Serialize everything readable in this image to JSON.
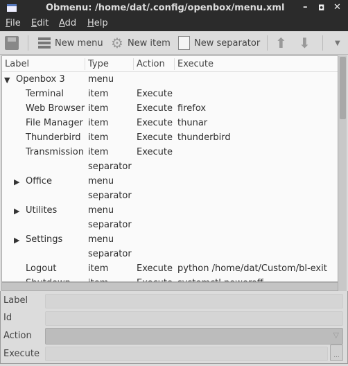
{
  "window": {
    "title": "Obmenu: /home/dat/.config/openbox/menu.xml",
    "minimize": "–",
    "maximize": "◘",
    "close": "✕"
  },
  "menubar": [
    "File",
    "Edit",
    "Add",
    "Help"
  ],
  "toolbar": {
    "new_menu": "New menu",
    "new_item": "New item",
    "new_separator": "New separator",
    "more": "▼"
  },
  "columns": [
    "Label",
    "Type",
    "Action",
    "Execute"
  ],
  "rows": [
    {
      "label": "Openbox 3",
      "type": "menu",
      "action": "",
      "execute": "",
      "level": 0,
      "expander": "▼"
    },
    {
      "label": "Terminal",
      "type": "item",
      "action": "Execute",
      "execute": "",
      "level": 1
    },
    {
      "label": "Web Browser",
      "type": "item",
      "action": "Execute",
      "execute": "firefox",
      "level": 1
    },
    {
      "label": "File Manager",
      "type": "item",
      "action": "Execute",
      "execute": "thunar",
      "level": 1
    },
    {
      "label": "Thunderbird",
      "type": "item",
      "action": "Execute",
      "execute": "thunderbird",
      "level": 1
    },
    {
      "label": "Transmission",
      "type": "item",
      "action": "Execute",
      "execute": "",
      "level": 1
    },
    {
      "label": "",
      "type": "separator",
      "action": "",
      "execute": "",
      "level": 1
    },
    {
      "label": "Office",
      "type": "menu",
      "action": "",
      "execute": "",
      "level": 1,
      "expander": "▶"
    },
    {
      "label": "",
      "type": "separator",
      "action": "",
      "execute": "",
      "level": 1
    },
    {
      "label": "Utilites",
      "type": "menu",
      "action": "",
      "execute": "",
      "level": 1,
      "expander": "▶"
    },
    {
      "label": "",
      "type": "separator",
      "action": "",
      "execute": "",
      "level": 1
    },
    {
      "label": "Settings",
      "type": "menu",
      "action": "",
      "execute": "",
      "level": 1,
      "expander": "▶"
    },
    {
      "label": "",
      "type": "separator",
      "action": "",
      "execute": "",
      "level": 1
    },
    {
      "label": "Logout",
      "type": "item",
      "action": "Execute",
      "execute": "python /home/dat/Custom/bl-exit",
      "level": 1
    },
    {
      "label": "Shutdown",
      "type": "item",
      "action": "Execute",
      "execute": "systemctl poweroff",
      "level": 1
    }
  ],
  "form": {
    "label": "Label",
    "id": "Id",
    "action": "Action",
    "execute": "Execute",
    "browse": "...",
    "combo_arrow": "▽"
  }
}
